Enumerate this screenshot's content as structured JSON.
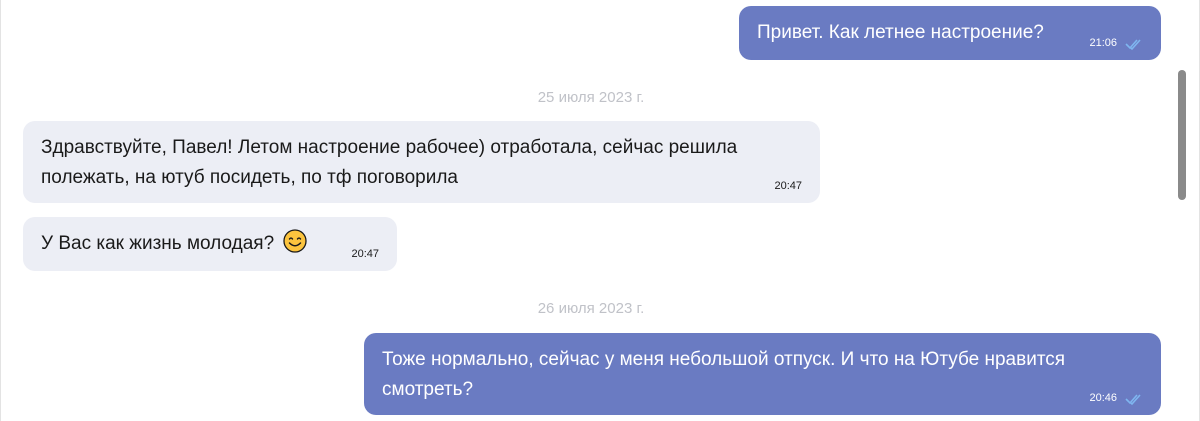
{
  "messages": [
    {
      "direction": "out",
      "text": "Привет. Как летнее настроение?",
      "time": "21:06",
      "status_icon": "double-check-icon"
    },
    {
      "direction": "in",
      "text_line1": "Здравствуйте, Павел! Летом настроение рабочее) отработала, сейчас решила",
      "text_line2": "полежать, на ютуб посидеть, по тф поговорила",
      "time": "20:47"
    },
    {
      "direction": "in",
      "text": "У Вас как жизнь молодая?",
      "emoji": "smiling-face-icon",
      "time": "20:47"
    },
    {
      "direction": "out",
      "text_line1": "Тоже нормально, сейчас у меня небольшой отпуск. И что на Ютубе нравится",
      "text_line2": "смотреть?",
      "time": "20:46",
      "status_icon": "double-check-icon"
    }
  ],
  "date_separators": [
    "25 июля 2023 г.",
    "26 июля 2023 г."
  ],
  "colors": {
    "outgoing_bubble": "#6a7bc2",
    "incoming_bubble": "#eceef5",
    "date_text": "#c0c2c8",
    "check_mark": "#7fb6f0"
  }
}
